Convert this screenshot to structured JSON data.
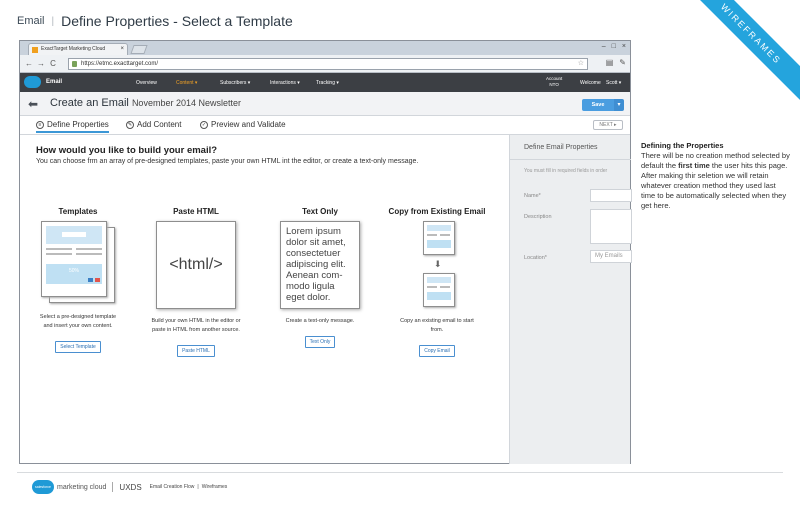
{
  "page": {
    "crumb": "Email",
    "title": "Define Properties - Select a Template",
    "ribbon": "WIREFRAMES"
  },
  "browser": {
    "tab_title": "ExactTarget Marketing Cloud",
    "url": "https://etmc.exacttarget.com/"
  },
  "appnav": {
    "app_name": "Email",
    "items": [
      "Overview",
      "Content",
      "Subscribers",
      "Interactions",
      "Tracking"
    ],
    "active": "Content",
    "account_label": "Account",
    "account_value": "NTO",
    "welcome": "Welcome",
    "user": "Scott"
  },
  "titlebar": {
    "title": "Create an Email",
    "subtitle": "November 2014 Newsletter",
    "save_label": "Save"
  },
  "steps": [
    "Define Properties",
    "Add Content",
    "Preview and Validate"
  ],
  "next_label": "NEXT",
  "content": {
    "question": "How would you like to build your email?",
    "question_sub": "You can choose frm an array of pre-designed templates, paste your own HTML int the editor, or create a text-only message.",
    "options": [
      {
        "title": "Templates",
        "desc_line1": "Select a pre-designed template",
        "desc_line2": "and insert your own content.",
        "button": "Select Template",
        "art_text": "50%"
      },
      {
        "title": "Paste HTML",
        "desc_line1": "Build your own HTML in the editor or",
        "desc_line2": "paste in HTML from another source.",
        "button": "Paste HTML",
        "art_text": "<html/>"
      },
      {
        "title": "Text Only",
        "desc_line1": "Create a text-only message.",
        "desc_line2": "",
        "button": "Text Only",
        "art_text": "Lorem ipsum dolor sit amet, consectetuer adipiscing elit. Aenean com-modo ligula eget dolor."
      },
      {
        "title": "Copy from Existing Email",
        "desc_line1": "Copy an existing email to start",
        "desc_line2": "from.",
        "button": "Copy Email"
      }
    ]
  },
  "props": {
    "title": "Define Email Properties",
    "hint": "You must fill in required fields in order",
    "name_label": "Name*",
    "description_label": "Description",
    "location_label": "Location*",
    "location_placeholder": "My Emails"
  },
  "annotation": {
    "title": "Defining the Properties",
    "body_1": "There will be no creation method selected by default the ",
    "body_bold": "first time",
    "body_2": " the user hits this page. After making thir seletion we will retain whatever creation method they used last time to be automatically selected when they get here."
  },
  "footer": {
    "cloud_text": "salesforce",
    "brand": "marketing cloud",
    "uxds": "UXDS",
    "flow": "Email Creation Flow",
    "wireframes": "Wireframes"
  },
  "colors": {
    "accent": "#24a4dd",
    "nav_bg": "#3c3f44",
    "nav_active": "#f3a224",
    "save_button": "#4a9de0"
  }
}
